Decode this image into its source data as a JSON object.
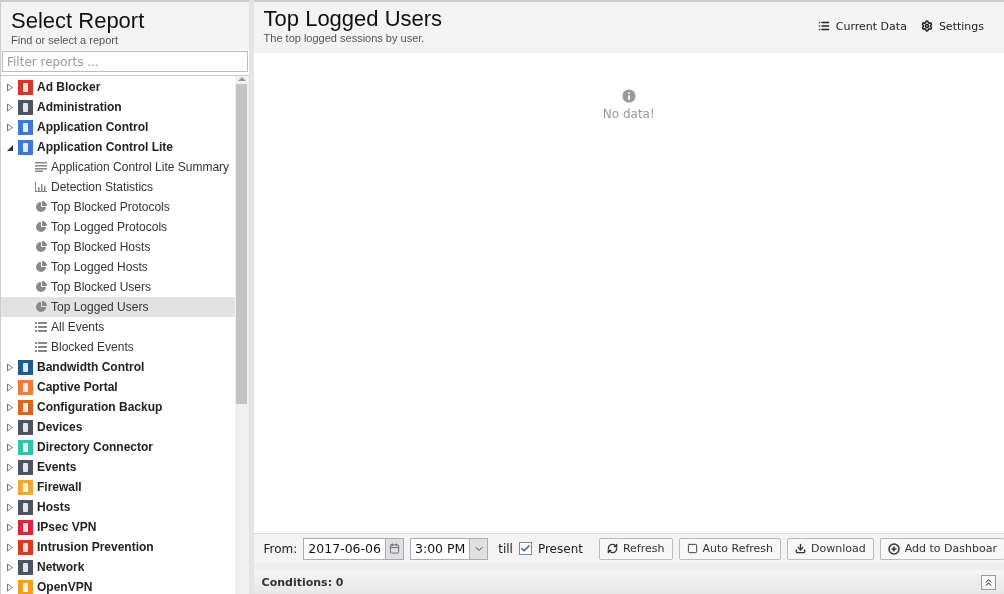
{
  "sidebar": {
    "title": "Select Report",
    "subtitle": "Find or select a report",
    "filter": {
      "placeholder": "Filter reports ..."
    },
    "tree": [
      {
        "label": "Ad Blocker",
        "color": "#d7342b",
        "expanded": false
      },
      {
        "label": "Administration",
        "color": "#4a5561",
        "expanded": false
      },
      {
        "label": "Application Control",
        "color": "#3c78d8",
        "expanded": false
      },
      {
        "label": "Application Control Lite",
        "color": "#3c78d8",
        "expanded": true,
        "children": [
          {
            "label": "Application Control Lite Summary",
            "kind": "summary",
            "selected": false
          },
          {
            "label": "Detection Statistics",
            "kind": "bars",
            "selected": false
          },
          {
            "label": "Top Blocked Protocols",
            "kind": "pie",
            "selected": false
          },
          {
            "label": "Top Logged Protocols",
            "kind": "pie",
            "selected": false
          },
          {
            "label": "Top Blocked Hosts",
            "kind": "pie",
            "selected": false
          },
          {
            "label": "Top Logged Hosts",
            "kind": "pie",
            "selected": false
          },
          {
            "label": "Top Blocked Users",
            "kind": "pie",
            "selected": false
          },
          {
            "label": "Top Logged Users",
            "kind": "pie",
            "selected": true
          },
          {
            "label": "All Events",
            "kind": "list",
            "selected": false
          },
          {
            "label": "Blocked Events",
            "kind": "list",
            "selected": false
          }
        ]
      },
      {
        "label": "Bandwidth Control",
        "color": "#1f5c8b",
        "expanded": false
      },
      {
        "label": "Captive Portal",
        "color": "#f07c3c",
        "expanded": false
      },
      {
        "label": "Configuration Backup",
        "color": "#d9661f",
        "expanded": false
      },
      {
        "label": "Devices",
        "color": "#4a5561",
        "expanded": false
      },
      {
        "label": "Directory Connector",
        "color": "#2ec4a8",
        "expanded": false
      },
      {
        "label": "Events",
        "color": "#4a5561",
        "expanded": false
      },
      {
        "label": "Firewall",
        "color": "#f0a830",
        "expanded": false
      },
      {
        "label": "Hosts",
        "color": "#4a5561",
        "expanded": false
      },
      {
        "label": "IPsec VPN",
        "color": "#d7263d",
        "expanded": false
      },
      {
        "label": "Intrusion Prevention",
        "color": "#d9391f",
        "expanded": false
      },
      {
        "label": "Network",
        "color": "#4a5561",
        "expanded": false
      },
      {
        "label": "OpenVPN",
        "color": "#f0a020",
        "expanded": false
      }
    ]
  },
  "report": {
    "title": "Top Logged Users",
    "subtitle": "The top logged sessions by user.",
    "actions": [
      "Current Data",
      "Settings"
    ],
    "empty_message": "No data!"
  },
  "toolbar": {
    "from_label": "From:",
    "date": "2017-06-06",
    "time": "3:00 PM",
    "till_label": "till",
    "present": {
      "label": "Present",
      "checked": true
    },
    "buttons": [
      {
        "label": "Refresh",
        "kind": "refresh"
      },
      {
        "label": "Auto Refresh",
        "kind": "toggle"
      },
      {
        "label": "Download",
        "kind": "download"
      },
      {
        "label": "Add to Dashboar",
        "kind": "add"
      }
    ]
  },
  "conditions": {
    "label": "Conditions: 0"
  }
}
